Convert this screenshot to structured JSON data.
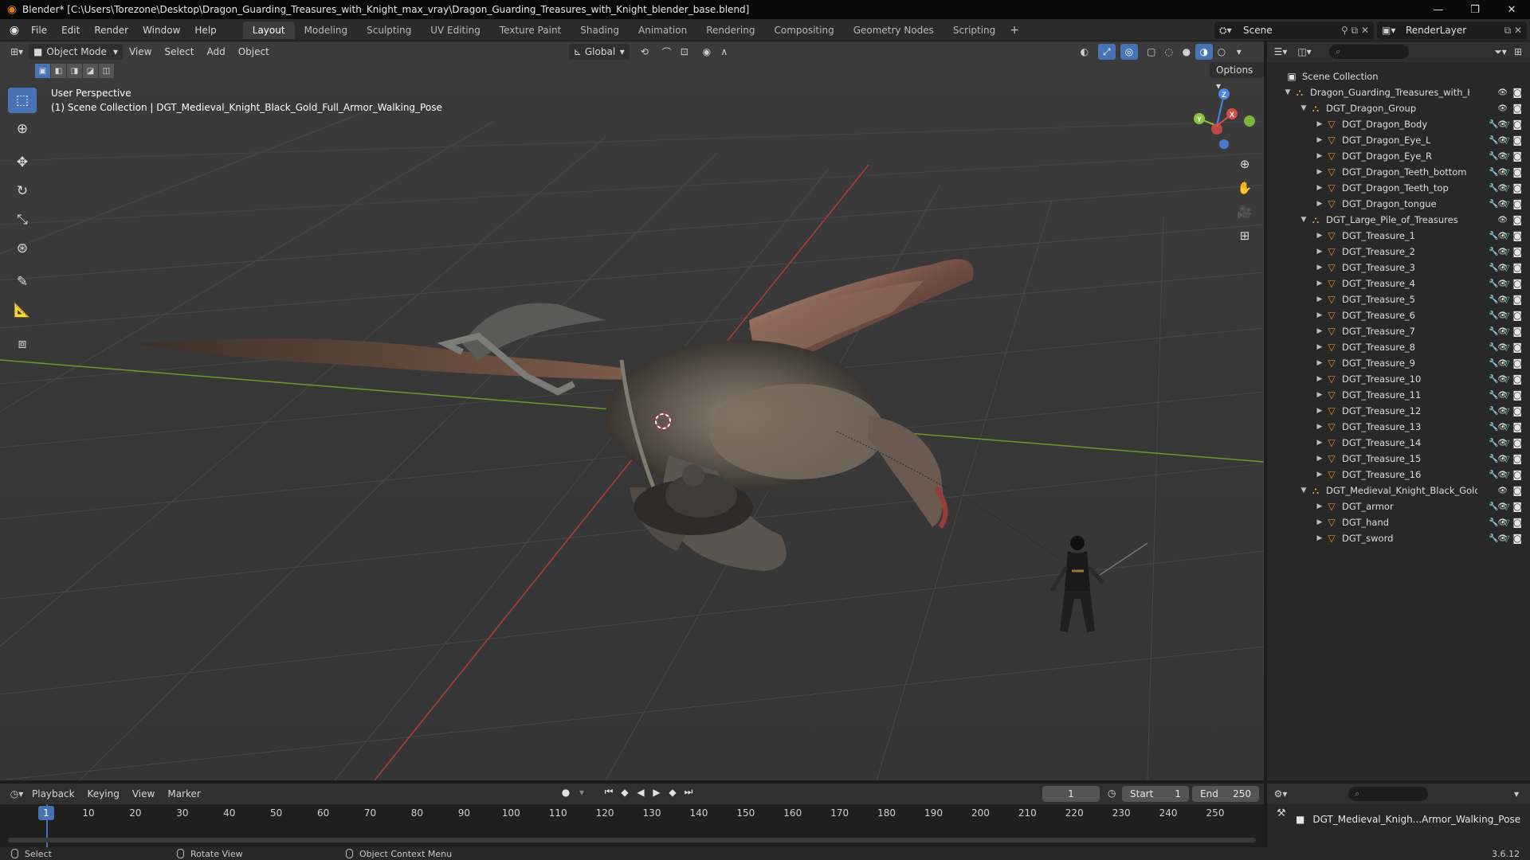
{
  "window": {
    "title": "Blender* [C:\\Users\\Torezone\\Desktop\\Dragon_Guarding_Treasures_with_Knight_max_vray\\Dragon_Guarding_Treasures_with_Knight_blender_base.blend]",
    "minimize": "—",
    "maximize": "❐",
    "close": "✕"
  },
  "menubar": {
    "menus": [
      "File",
      "Edit",
      "Render",
      "Window",
      "Help"
    ],
    "workspaces": [
      "Layout",
      "Modeling",
      "Sculpting",
      "UV Editing",
      "Texture Paint",
      "Shading",
      "Animation",
      "Rendering",
      "Compositing",
      "Geometry Nodes",
      "Scripting"
    ],
    "active_workspace": "Layout",
    "add_label": "+",
    "scene": "Scene",
    "view_layer": "RenderLayer"
  },
  "viewport": {
    "mode": "Object Mode",
    "menus": [
      "View",
      "Select",
      "Add",
      "Object"
    ],
    "transform_orientation": "Global",
    "options_label": "Options",
    "perspective": "User Perspective",
    "context": "(1) Scene Collection | DGT_Medieval_Knight_Black_Gold_Full_Armor_Walking_Pose",
    "gizmo": {
      "x": "X",
      "y": "Y",
      "z": "Z"
    }
  },
  "toolbar_icons": [
    "select-box-icon",
    "cursor-icon",
    "move-icon",
    "rotate-icon",
    "scale-icon",
    "transform-icon",
    "annotate-icon",
    "measure-icon",
    "add-cube-icon"
  ],
  "outliner": {
    "root": "Scene Collection",
    "items": [
      {
        "name": "Dragon_Guarding_Treasures_with_Knigh",
        "level": 0,
        "type": "collection",
        "expanded": true
      },
      {
        "name": "DGT_Dragon_Group",
        "level": 1,
        "type": "collection",
        "expanded": true
      },
      {
        "name": "DGT_Dragon_Body",
        "level": 2,
        "type": "mesh"
      },
      {
        "name": "DGT_Dragon_Eye_L",
        "level": 2,
        "type": "mesh"
      },
      {
        "name": "DGT_Dragon_Eye_R",
        "level": 2,
        "type": "mesh"
      },
      {
        "name": "DGT_Dragon_Teeth_bottom",
        "level": 2,
        "type": "mesh"
      },
      {
        "name": "DGT_Dragon_Teeth_top",
        "level": 2,
        "type": "mesh"
      },
      {
        "name": "DGT_Dragon_tongue",
        "level": 2,
        "type": "mesh"
      },
      {
        "name": "DGT_Large_Pile_of_Treasures",
        "level": 1,
        "type": "collection",
        "expanded": true
      },
      {
        "name": "DGT_Treasure_1",
        "level": 2,
        "type": "mesh"
      },
      {
        "name": "DGT_Treasure_2",
        "level": 2,
        "type": "mesh"
      },
      {
        "name": "DGT_Treasure_3",
        "level": 2,
        "type": "mesh"
      },
      {
        "name": "DGT_Treasure_4",
        "level": 2,
        "type": "mesh"
      },
      {
        "name": "DGT_Treasure_5",
        "level": 2,
        "type": "mesh"
      },
      {
        "name": "DGT_Treasure_6",
        "level": 2,
        "type": "mesh"
      },
      {
        "name": "DGT_Treasure_7",
        "level": 2,
        "type": "mesh"
      },
      {
        "name": "DGT_Treasure_8",
        "level": 2,
        "type": "mesh"
      },
      {
        "name": "DGT_Treasure_9",
        "level": 2,
        "type": "mesh"
      },
      {
        "name": "DGT_Treasure_10",
        "level": 2,
        "type": "mesh"
      },
      {
        "name": "DGT_Treasure_11",
        "level": 2,
        "type": "mesh"
      },
      {
        "name": "DGT_Treasure_12",
        "level": 2,
        "type": "mesh"
      },
      {
        "name": "DGT_Treasure_13",
        "level": 2,
        "type": "mesh"
      },
      {
        "name": "DGT_Treasure_14",
        "level": 2,
        "type": "mesh"
      },
      {
        "name": "DGT_Treasure_15",
        "level": 2,
        "type": "mesh"
      },
      {
        "name": "DGT_Treasure_16",
        "level": 2,
        "type": "mesh"
      },
      {
        "name": "DGT_Medieval_Knight_Black_Gold_I",
        "level": 1,
        "type": "collection",
        "expanded": true
      },
      {
        "name": "DGT_armor",
        "level": 2,
        "type": "mesh"
      },
      {
        "name": "DGT_hand",
        "level": 2,
        "type": "mesh"
      },
      {
        "name": "DGT_sword",
        "level": 2,
        "type": "mesh"
      }
    ]
  },
  "properties": {
    "active_object": "DGT_Medieval_Knigh...Armor_Walking_Pose"
  },
  "timeline": {
    "menus": [
      "Playback",
      "Keying",
      "View",
      "Marker"
    ],
    "current_frame": "1",
    "start_label": "Start",
    "start": "1",
    "end_label": "End",
    "end": "250",
    "ticks": [
      "10",
      "20",
      "30",
      "40",
      "50",
      "60",
      "70",
      "80",
      "90",
      "100",
      "110",
      "120",
      "130",
      "140",
      "150",
      "160",
      "170",
      "180",
      "190",
      "200",
      "210",
      "220",
      "230",
      "240",
      "250"
    ]
  },
  "statusbar": {
    "select": "Select",
    "rotate": "Rotate View",
    "context_menu": "Object Context Menu",
    "version": "3.6.12"
  },
  "colors": {
    "accent": "#4772b3",
    "x_axis": "#d94a4a",
    "y_axis": "#8cc63f",
    "z_axis": "#4a86e8"
  }
}
